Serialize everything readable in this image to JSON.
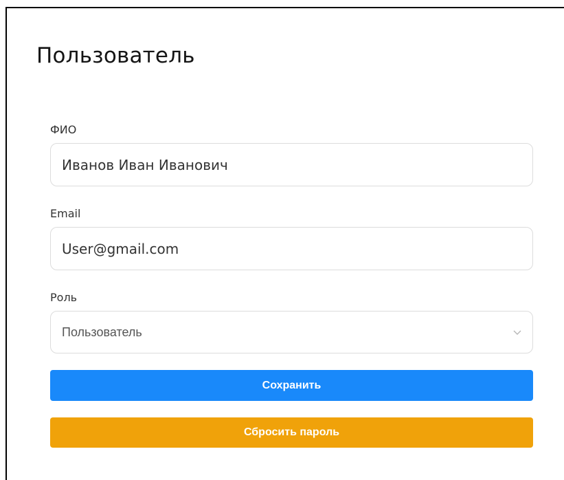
{
  "page": {
    "title": "Пользователь"
  },
  "form": {
    "full_name": {
      "label": "ФИО",
      "value": "Иванов Иван Иванович"
    },
    "email": {
      "label": "Email",
      "value": "User@gmail.com"
    },
    "role": {
      "label": "Роль",
      "selected": "Пользователь",
      "icon": "chevron-down-icon"
    },
    "save_label": "Сохранить",
    "reset_password_label": "Сбросить пароль"
  },
  "colors": {
    "save_button": "#1989fa",
    "reset_button": "#f0a20a",
    "input_border": "#dcdcdc"
  }
}
